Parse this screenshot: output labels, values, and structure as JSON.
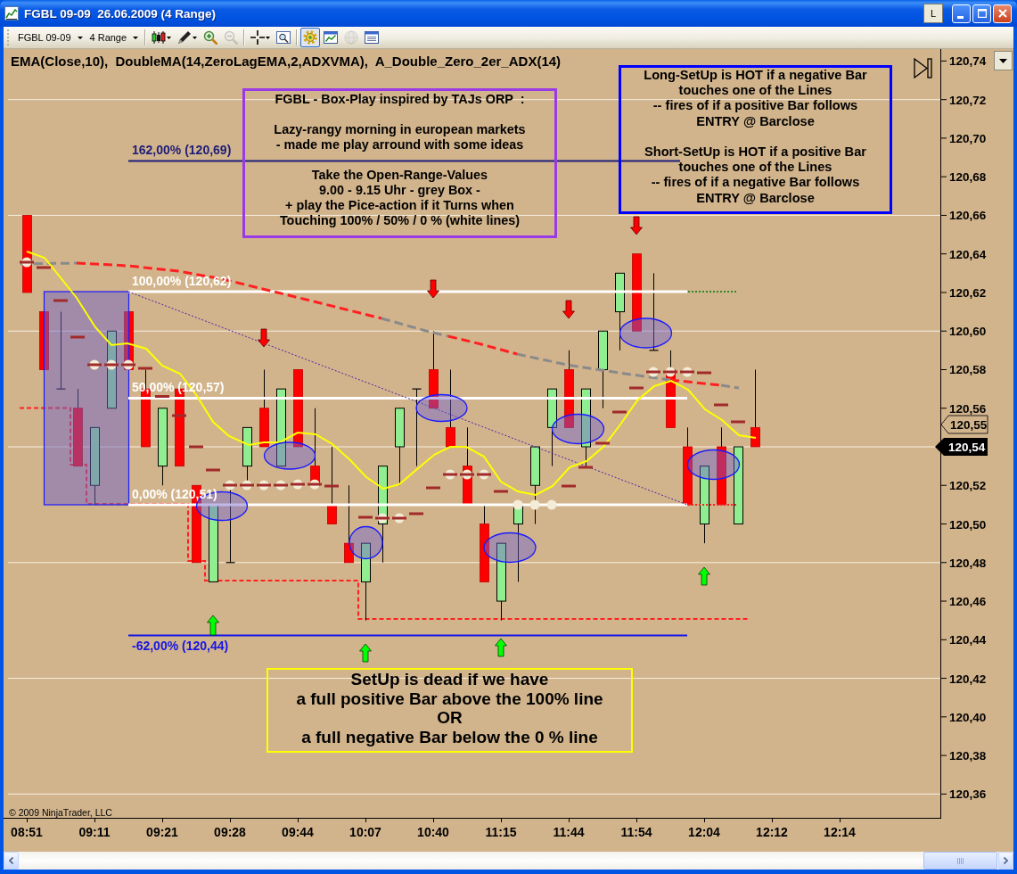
{
  "window": {
    "title": "FGBL 09-09  26.06.2009 (4 Range)",
    "corner_button": "L"
  },
  "toolbar": {
    "instrument": "FGBL 09-09",
    "period": "4 Range",
    "groups": [
      [
        {
          "kind": "candles",
          "dropdown": true,
          "on": false,
          "disabled": false
        },
        {
          "kind": "pen",
          "dropdown": true,
          "on": false,
          "disabled": false
        },
        {
          "kind": "zoom_in",
          "dropdown": false,
          "on": false,
          "disabled": false
        },
        {
          "kind": "zoom_out",
          "dropdown": false,
          "on": false,
          "disabled": true
        }
      ],
      [
        {
          "kind": "crosshair",
          "dropdown": true,
          "on": false,
          "disabled": false
        },
        {
          "kind": "zoom_box",
          "dropdown": false,
          "on": false,
          "disabled": false
        }
      ],
      [
        {
          "kind": "strategy",
          "dropdown": false,
          "on": true,
          "disabled": false
        },
        {
          "kind": "chart",
          "dropdown": false,
          "on": false,
          "disabled": false
        },
        {
          "kind": "globe",
          "dropdown": false,
          "on": false,
          "disabled": true
        },
        {
          "kind": "data_box",
          "dropdown": false,
          "on": false,
          "disabled": false
        }
      ]
    ]
  },
  "chart": {
    "legend": "EMA(Close,10),  DoubleMA(14,ZeroLagEMA,2,ADXVMA),  A_Double_Zero_2er_ADX(14)",
    "levels": [
      {
        "kind": "upper_extension",
        "label": "162,00% (120,69)"
      },
      {
        "kind": "range",
        "label": "100,00% (120,62)"
      },
      {
        "kind": "range",
        "label": "50,00% (120,57)"
      },
      {
        "kind": "range",
        "label": "0,00% (120,51)"
      },
      {
        "kind": "lower_extension",
        "label": "-62,00% (120,44)"
      }
    ],
    "notes": [
      {
        "color": "#9a3ae6",
        "paragraphs": [
          [
            "FGBL - Box-Play inspired by TAJs ORP  :"
          ],
          [
            "Lazy-rangy morning in european markets",
            "- made me play arround with some ideas"
          ],
          [
            "Take the Open-Range-Values",
            "9.00 - 9.15 Uhr - grey Box -",
            "+ play the Pice-action if it Turns when",
            "Touching 100% / 50% / 0 % (white lines)"
          ]
        ]
      },
      {
        "color": "#0000ff",
        "paragraphs": [
          [
            "Long-SetUp is HOT if a negative Bar",
            "touches one of the Lines",
            "-- fires of if a positive Bar follows",
            "ENTRY @ Barclose"
          ],
          [
            "Short-SetUp is HOT if a positive Bar",
            "touches one of the Lines",
            "-- fires of if a negative Bar follows",
            "ENTRY @ Barclose"
          ]
        ]
      },
      {
        "color": "#ffff00",
        "paragraphs": [
          [
            "SetUp is dead if we have",
            "a full positive Bar above the 100% line",
            "OR",
            "a full negative Bar below the 0 % line"
          ]
        ]
      }
    ],
    "y_axis": [
      "120,74",
      "120,72",
      "120,70",
      "120,68",
      "120,66",
      "120,64",
      "120,62",
      "120,60",
      "120,58",
      "120,56",
      "120,52",
      "120,50",
      "120,48",
      "120,46",
      "120,44",
      "120,42",
      "120,40",
      "120,38",
      "120,36"
    ],
    "price_markers": [
      {
        "kind": "outline",
        "label": "120,55"
      },
      {
        "kind": "filled",
        "label": "120,54"
      }
    ],
    "x_axis": [
      "08:51",
      "09:11",
      "09:21",
      "09:28",
      "09:44",
      "10:07",
      "10:40",
      "11:15",
      "11:44",
      "11:54",
      "12:04",
      "12:12",
      "12:14"
    ],
    "copyright": "© 2009 NinjaTrader, LLC"
  }
}
